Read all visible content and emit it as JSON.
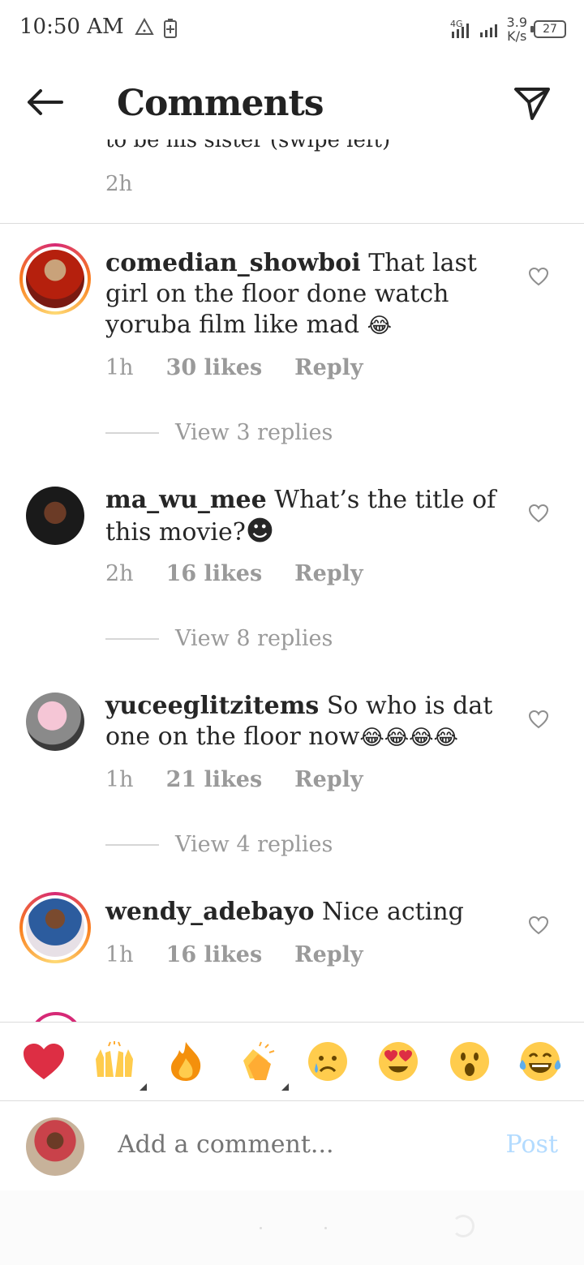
{
  "status_bar": {
    "time": "10:50 AM",
    "network_type": "4G",
    "speed_value": "3.9",
    "speed_unit": "K/s",
    "battery": "27"
  },
  "header": {
    "title": "Comments",
    "back_icon": "arrow-left-icon",
    "send_icon": "paper-plane-icon"
  },
  "previous_comment": {
    "text_fragment": "to be his sister (swipe left)",
    "time": "2h"
  },
  "comments": [
    {
      "username": "comedian_showboi",
      "text": "That last girl on the floor done watch yoruba film like mad",
      "emoji": "😂",
      "time": "1h",
      "likes": "30 likes",
      "reply": "Reply",
      "view_replies": "View 3 replies",
      "story_ring": true
    },
    {
      "username": "ma_wu_mee",
      "text": "What’s the title of this movie?",
      "emoji": "☻",
      "time": "2h",
      "likes": "16 likes",
      "reply": "Reply",
      "view_replies": "View 8 replies",
      "story_ring": false
    },
    {
      "username": "yuceeglitzitems",
      "text": "So who is dat one on the floor now",
      "emoji": "😂😂😂😂",
      "time": "1h",
      "likes": "21 likes",
      "reply": "Reply",
      "view_replies": "View 4 replies",
      "story_ring": false
    },
    {
      "username": "wendy_adebayo",
      "text": "Nice acting",
      "emoji": "",
      "time": "1h",
      "likes": "16 likes",
      "reply": "Reply",
      "story_ring": true
    }
  ],
  "reactions": [
    {
      "name": "red-heart",
      "glyph": "❤"
    },
    {
      "name": "raising-hands",
      "glyph": "🙌"
    },
    {
      "name": "fire",
      "glyph": "🔥"
    },
    {
      "name": "clapping-hands",
      "glyph": "👏"
    },
    {
      "name": "crying-face",
      "glyph": "😢"
    },
    {
      "name": "heart-eyes",
      "glyph": "😍"
    },
    {
      "name": "surprised-face",
      "glyph": "😮"
    },
    {
      "name": "tears-of-joy",
      "glyph": "😂"
    }
  ],
  "composer": {
    "placeholder": "Add a comment...",
    "post_label": "Post"
  },
  "colors": {
    "post_disabled": "#b3dbff",
    "meta_grey": "#9a9a9a",
    "text": "#262626"
  }
}
